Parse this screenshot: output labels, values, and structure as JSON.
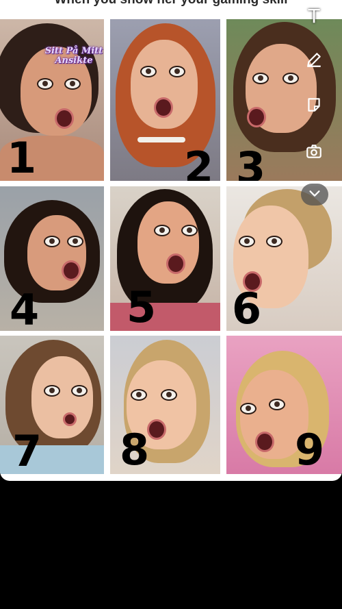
{
  "caption": "When you show her your gaming skill",
  "watermark": "Sitt På Mitt Ansikte",
  "numbers": [
    "1",
    "2",
    "3",
    "4",
    "5",
    "6",
    "7",
    "8",
    "9"
  ],
  "tools": [
    {
      "name": "text-tool-icon",
      "glyph": "T"
    },
    {
      "name": "pen-icon"
    },
    {
      "name": "sticker-icon"
    },
    {
      "name": "camera-rotate-icon"
    },
    {
      "name": "chevron-down-icon"
    }
  ],
  "colors": {
    "background": "#000000",
    "card": "#ffffff"
  }
}
